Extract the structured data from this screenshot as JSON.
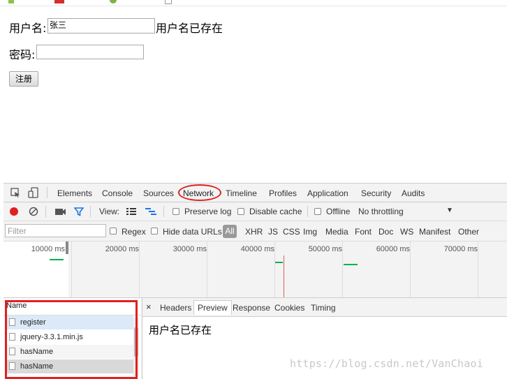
{
  "form": {
    "username_label": "用户名:",
    "username_value": "张三",
    "username_status": "用户名已存在",
    "password_label": "密码:",
    "password_value": "",
    "register_button": "注册"
  },
  "devtools": {
    "tabs": [
      "Elements",
      "Console",
      "Sources",
      "Network",
      "Timeline",
      "Profiles",
      "Application",
      "Security",
      "Audits"
    ],
    "active_tab": "Network",
    "toolbar": {
      "view_label": "View:",
      "preserve_log": "Preserve log",
      "disable_cache": "Disable cache",
      "offline": "Offline",
      "throttling": "No throttling"
    },
    "filter": {
      "placeholder": "Filter",
      "regex": "Regex",
      "hide_data_urls": "Hide data URLs",
      "types": [
        "All",
        "XHR",
        "JS",
        "CSS",
        "Img",
        "Media",
        "Font",
        "Doc",
        "WS",
        "Manifest",
        "Other"
      ],
      "active_type": "All"
    },
    "timeline_ticks": [
      "10000 ms",
      "20000 ms",
      "30000 ms",
      "40000 ms",
      "50000 ms",
      "60000 ms",
      "70000 ms"
    ],
    "requests_header": "Name",
    "requests": [
      "register",
      "jquery-3.3.1.min.js",
      "hasName",
      "hasName"
    ],
    "detail_close": "×",
    "detail_tabs": [
      "Headers",
      "Preview",
      "Response",
      "Cookies",
      "Timing"
    ],
    "active_detail_tab": "Preview",
    "preview_text": "用户名已存在"
  },
  "watermark": "https://blog.csdn.net/VanChaoi",
  "colors": {
    "annotation_red": "#e02020",
    "record_red": "#e02020",
    "filter_blue": "#1a73e8",
    "selected_row": "#dbe9f9",
    "hover_row": "#d9d9d9",
    "timeline_green": "#00b050"
  }
}
